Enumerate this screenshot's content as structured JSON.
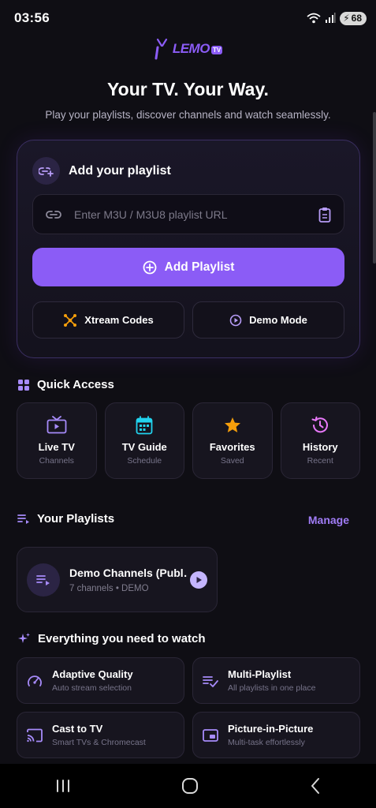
{
  "status_bar": {
    "time": "03:56",
    "battery": "68"
  },
  "logo": {
    "text": "LEMO",
    "badge": "TV"
  },
  "hero": {
    "title": "Your TV. Your Way.",
    "subtitle": "Play your playlists, discover channels and watch seamlessly."
  },
  "add_playlist": {
    "title": "Add your playlist",
    "input_placeholder": "Enter M3U / M3U8 playlist URL",
    "input_value": "",
    "add_button": "Add Playlist",
    "xtream_button": "Xtream Codes",
    "demo_button": "Demo Mode"
  },
  "quick_access": {
    "title": "Quick Access",
    "items": [
      {
        "title": "Live TV",
        "subtitle": "Channels",
        "icon": "tv-icon"
      },
      {
        "title": "TV Guide",
        "subtitle": "Schedule",
        "icon": "calendar-icon"
      },
      {
        "title": "Favorites",
        "subtitle": "Saved",
        "icon": "star-icon"
      },
      {
        "title": "History",
        "subtitle": "Recent",
        "icon": "history-icon"
      }
    ]
  },
  "playlists": {
    "title": "Your Playlists",
    "manage": "Manage",
    "items": [
      {
        "title": "Demo Channels (Publ…",
        "subtitle": "7 channels • DEMO"
      }
    ]
  },
  "features": {
    "title": "Everything you need to watch",
    "items": [
      {
        "title": "Adaptive Quality",
        "subtitle": "Auto stream selection",
        "icon": "speedometer-icon"
      },
      {
        "title": "Multi-Playlist",
        "subtitle": "All playlists in one place",
        "icon": "playlist-check-icon"
      },
      {
        "title": "Cast to TV",
        "subtitle": "Smart TVs & Chromecast",
        "icon": "cast-icon"
      },
      {
        "title": "Picture-in-Picture",
        "subtitle": "Multi-task effortlessly",
        "icon": "pip-icon"
      }
    ]
  },
  "colors": {
    "accent": "#8b5cf6",
    "background": "#0f0e14",
    "card": "#17151f",
    "guide_teal": "#22d3ee",
    "favorite_gold": "#f59e0b",
    "history_pink": "#e879f9",
    "xtream_orange": "#f59e0b"
  }
}
